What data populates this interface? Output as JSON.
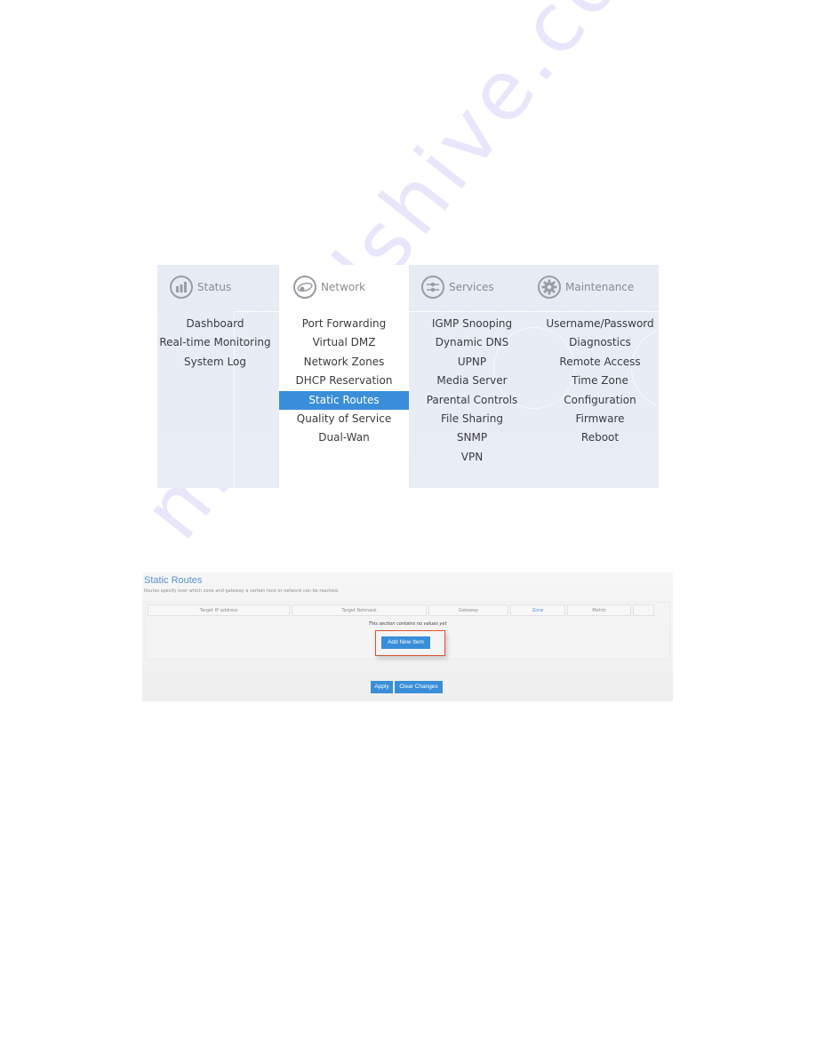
{
  "menu": {
    "columns": [
      {
        "key": "status",
        "title": "Status",
        "icon": "bar-chart-icon",
        "items": [
          {
            "label": "Dashboard"
          },
          {
            "label": "Real-time Monitoring"
          },
          {
            "label": "System Log"
          }
        ]
      },
      {
        "key": "network",
        "title": "Network",
        "icon": "network-orbit-icon",
        "items": [
          {
            "label": "Port Forwarding"
          },
          {
            "label": "Virtual DMZ"
          },
          {
            "label": "Network Zones"
          },
          {
            "label": "DHCP Reservation"
          },
          {
            "label": "Static Routes",
            "active": true
          },
          {
            "label": "Quality of Service"
          },
          {
            "label": "Dual-Wan"
          }
        ]
      },
      {
        "key": "services",
        "title": "Services",
        "icon": "sliders-icon",
        "items": [
          {
            "label": "IGMP Snooping"
          },
          {
            "label": "Dynamic DNS"
          },
          {
            "label": "UPNP"
          },
          {
            "label": "Media Server"
          },
          {
            "label": "Parental Controls"
          },
          {
            "label": "File Sharing"
          },
          {
            "label": "SNMP"
          },
          {
            "label": "VPN"
          }
        ]
      },
      {
        "key": "maintenance",
        "title": "Maintenance",
        "icon": "gear-icon",
        "items": [
          {
            "label": "Username/Password"
          },
          {
            "label": "Diagnostics"
          },
          {
            "label": "Remote Access"
          },
          {
            "label": "Time Zone"
          },
          {
            "label": "Configuration"
          },
          {
            "label": "Firmware"
          },
          {
            "label": "Reboot"
          }
        ]
      }
    ],
    "active_color": "#3a8ed9"
  },
  "static_routes": {
    "title": "Static Routes",
    "description": "Routes specify over which zone and gateway a certain host or network can be reached.",
    "columns": [
      "Target IP address",
      "Target Netmask",
      "Gateway",
      "Zone",
      "Metric",
      ""
    ],
    "empty_message": "This section contains no values yet",
    "add_button": "Add New Item",
    "apply_button": "Apply",
    "clear_button": "Clear Changes",
    "accent_color": "#3a8ed9",
    "highlight_color": "#e0532c"
  },
  "watermark": "manualshive.com"
}
